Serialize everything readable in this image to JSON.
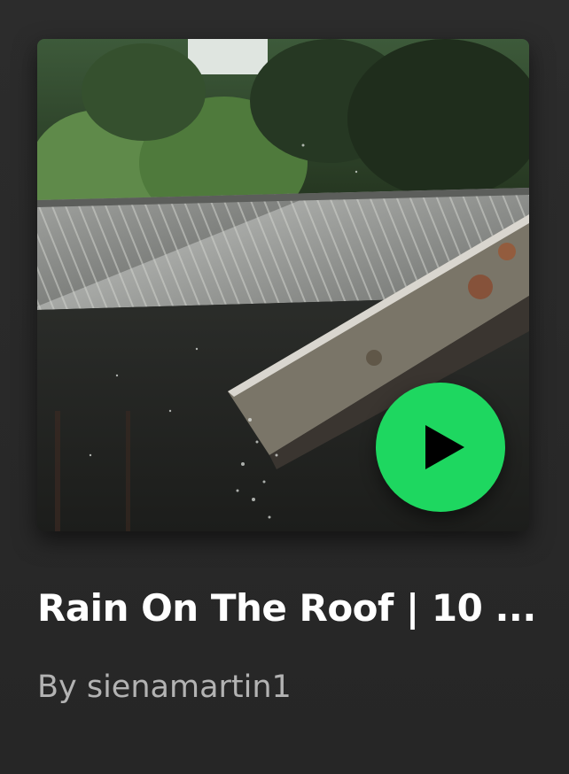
{
  "playlist": {
    "title": "Rain On The Roof | 10 ...",
    "byline": "By sienamartin1",
    "cover_image": "rain-on-roof-photo",
    "play_icon": "play-icon"
  },
  "colors": {
    "background": "#282828",
    "accent": "#1ed760",
    "title": "#ffffff",
    "subtitle": "#b3b3b3"
  }
}
